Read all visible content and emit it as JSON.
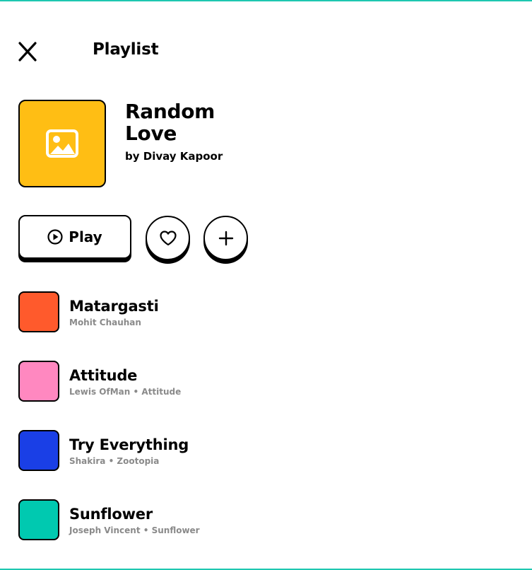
{
  "header": {
    "title": "Playlist",
    "close_icon": "close-icon"
  },
  "playlist": {
    "name": "Random Love",
    "owner": "by Divay Kapoor",
    "cover_color": "#ffbe14",
    "cover_icon": "image-icon"
  },
  "actions": {
    "play_label": "Play",
    "play_icon": "play-circle-icon",
    "like_icon": "heart-icon",
    "add_icon": "plus-icon"
  },
  "tracks": [
    {
      "title": "Matargasti",
      "subtitle": "Mohit Chauhan",
      "color": "#ff5a2c"
    },
    {
      "title": "Attitude",
      "subtitle": "Lewis OfMan • Attitude",
      "color": "#ff88c0"
    },
    {
      "title": "Try Everything",
      "subtitle": "Shakira • Zootopia",
      "color": "#1a3fe6"
    },
    {
      "title": "Sunflower",
      "subtitle": "Joseph Vincent • Sunflower",
      "color": "#00c9b0"
    }
  ],
  "colors": {
    "accent": "#1ec7b0",
    "text": "#000000",
    "muted": "#8a8a8a"
  }
}
